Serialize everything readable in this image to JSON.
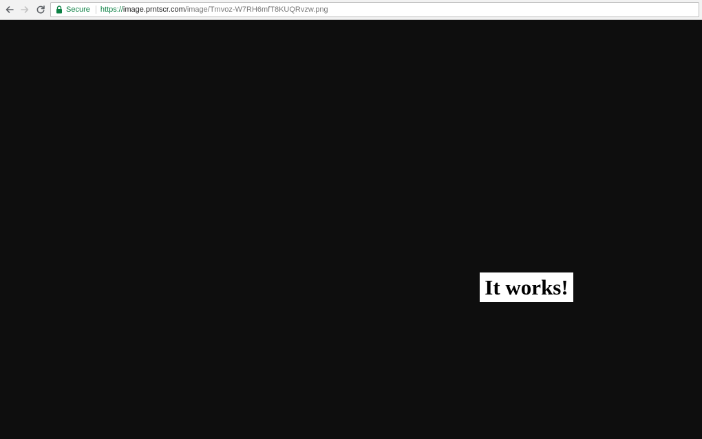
{
  "browser": {
    "icons": {
      "back": "back-arrow-icon",
      "forward": "forward-arrow-icon",
      "reload": "reload-icon",
      "lock": "lock-icon"
    },
    "security_label": "Secure",
    "url": {
      "scheme": "https://",
      "host": "image.prntscr.com",
      "path": "/image/Tmvoz-W7RH6mfT8KUQRvzw.png"
    },
    "colors": {
      "secure_green": "#0b8043"
    }
  },
  "page": {
    "background": "#0e0e0e",
    "message": "It works!"
  }
}
